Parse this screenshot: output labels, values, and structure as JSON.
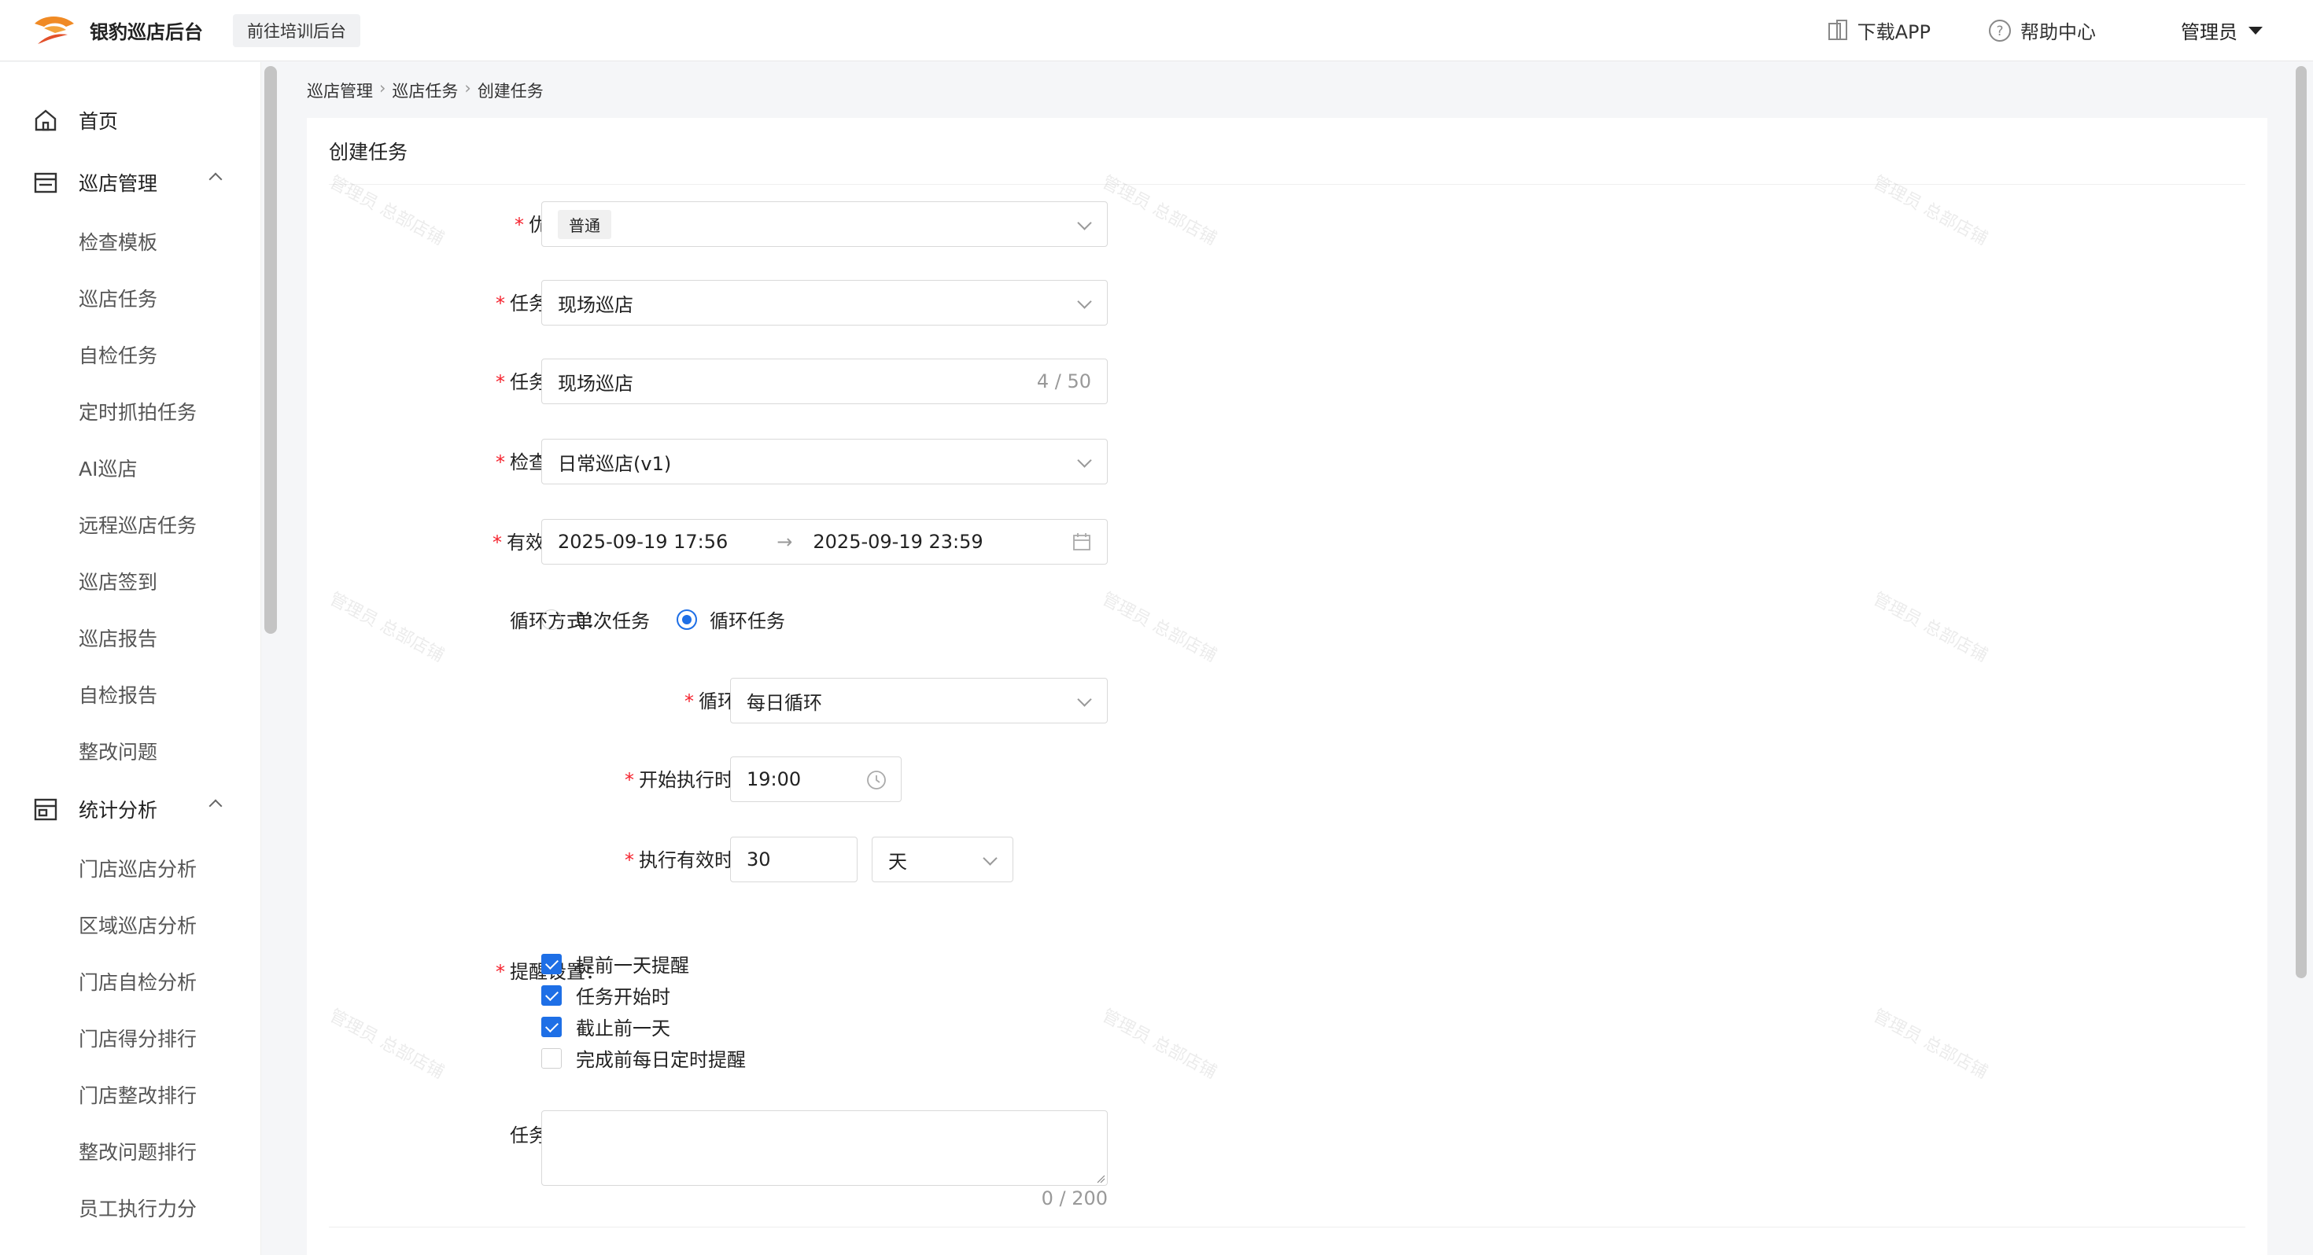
{
  "header": {
    "app_title": "银豹巡店后台",
    "training_btn": "前往培训后台",
    "download_app": "下载APP",
    "help_center": "帮助中心",
    "user": "管理员"
  },
  "sidebar": {
    "home": "首页",
    "patrol_mgmt": "巡店管理",
    "patrol_items": [
      "检查模板",
      "巡店任务",
      "自检任务",
      "定时抓拍任务",
      "AI巡店",
      "远程巡店任务",
      "巡店签到",
      "巡店报告",
      "自检报告",
      "整改问题"
    ],
    "stats": "统计分析",
    "stats_items": [
      "门店巡店分析",
      "区域巡店分析",
      "门店自检分析",
      "门店得分排行",
      "门店整改排行",
      "整改问题排行",
      "员工执行力分"
    ]
  },
  "breadcrumb": [
    "巡店管理",
    "巡店任务",
    "创建任务"
  ],
  "form": {
    "title": "创建任务",
    "priority": {
      "label": "优先级",
      "value": "普通"
    },
    "task_type": {
      "label": "任务类型",
      "value": "现场巡店"
    },
    "task_name": {
      "label": "任务名称",
      "value": "现场巡店",
      "count": "4 / 50"
    },
    "template": {
      "label": "检查模板",
      "value": "日常巡店(v1)"
    },
    "validity": {
      "label": "有效期",
      "start": "2025-09-19 17:56",
      "arrow": "→",
      "end": "2025-09-19 23:59"
    },
    "loop_mode": {
      "label": "循环方式",
      "opt1": "单次任务",
      "opt2": "循环任务"
    },
    "loop_period": {
      "label": "循环周期",
      "value": "每日循环"
    },
    "start_time": {
      "label": "开始执行时间",
      "value": "19:00"
    },
    "duration": {
      "label": "执行有效时长",
      "value": "30",
      "unit": "天"
    },
    "reminder": {
      "label": "提醒设置",
      "opts": [
        "提前一天提醒",
        "任务开始时",
        "截止前一天",
        "完成前每日定时提醒"
      ],
      "checked": [
        true,
        true,
        true,
        false
      ]
    },
    "desc": {
      "label": "任务说明",
      "count": "0 / 200"
    }
  },
  "watermark": "管理员 总部店铺",
  "colors": {
    "primary": "#1e6fe6",
    "required": "#f5222d"
  }
}
